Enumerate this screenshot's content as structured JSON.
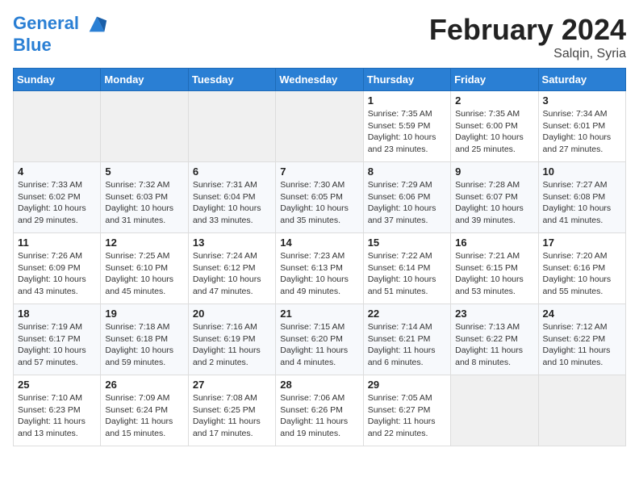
{
  "header": {
    "logo_line1": "General",
    "logo_line2": "Blue",
    "month_title": "February 2024",
    "subtitle": "Salqin, Syria"
  },
  "weekdays": [
    "Sunday",
    "Monday",
    "Tuesday",
    "Wednesday",
    "Thursday",
    "Friday",
    "Saturday"
  ],
  "weeks": [
    [
      {
        "day": "",
        "info": ""
      },
      {
        "day": "",
        "info": ""
      },
      {
        "day": "",
        "info": ""
      },
      {
        "day": "",
        "info": ""
      },
      {
        "day": "1",
        "info": "Sunrise: 7:35 AM\nSunset: 5:59 PM\nDaylight: 10 hours\nand 23 minutes."
      },
      {
        "day": "2",
        "info": "Sunrise: 7:35 AM\nSunset: 6:00 PM\nDaylight: 10 hours\nand 25 minutes."
      },
      {
        "day": "3",
        "info": "Sunrise: 7:34 AM\nSunset: 6:01 PM\nDaylight: 10 hours\nand 27 minutes."
      }
    ],
    [
      {
        "day": "4",
        "info": "Sunrise: 7:33 AM\nSunset: 6:02 PM\nDaylight: 10 hours\nand 29 minutes."
      },
      {
        "day": "5",
        "info": "Sunrise: 7:32 AM\nSunset: 6:03 PM\nDaylight: 10 hours\nand 31 minutes."
      },
      {
        "day": "6",
        "info": "Sunrise: 7:31 AM\nSunset: 6:04 PM\nDaylight: 10 hours\nand 33 minutes."
      },
      {
        "day": "7",
        "info": "Sunrise: 7:30 AM\nSunset: 6:05 PM\nDaylight: 10 hours\nand 35 minutes."
      },
      {
        "day": "8",
        "info": "Sunrise: 7:29 AM\nSunset: 6:06 PM\nDaylight: 10 hours\nand 37 minutes."
      },
      {
        "day": "9",
        "info": "Sunrise: 7:28 AM\nSunset: 6:07 PM\nDaylight: 10 hours\nand 39 minutes."
      },
      {
        "day": "10",
        "info": "Sunrise: 7:27 AM\nSunset: 6:08 PM\nDaylight: 10 hours\nand 41 minutes."
      }
    ],
    [
      {
        "day": "11",
        "info": "Sunrise: 7:26 AM\nSunset: 6:09 PM\nDaylight: 10 hours\nand 43 minutes."
      },
      {
        "day": "12",
        "info": "Sunrise: 7:25 AM\nSunset: 6:10 PM\nDaylight: 10 hours\nand 45 minutes."
      },
      {
        "day": "13",
        "info": "Sunrise: 7:24 AM\nSunset: 6:12 PM\nDaylight: 10 hours\nand 47 minutes."
      },
      {
        "day": "14",
        "info": "Sunrise: 7:23 AM\nSunset: 6:13 PM\nDaylight: 10 hours\nand 49 minutes."
      },
      {
        "day": "15",
        "info": "Sunrise: 7:22 AM\nSunset: 6:14 PM\nDaylight: 10 hours\nand 51 minutes."
      },
      {
        "day": "16",
        "info": "Sunrise: 7:21 AM\nSunset: 6:15 PM\nDaylight: 10 hours\nand 53 minutes."
      },
      {
        "day": "17",
        "info": "Sunrise: 7:20 AM\nSunset: 6:16 PM\nDaylight: 10 hours\nand 55 minutes."
      }
    ],
    [
      {
        "day": "18",
        "info": "Sunrise: 7:19 AM\nSunset: 6:17 PM\nDaylight: 10 hours\nand 57 minutes."
      },
      {
        "day": "19",
        "info": "Sunrise: 7:18 AM\nSunset: 6:18 PM\nDaylight: 10 hours\nand 59 minutes."
      },
      {
        "day": "20",
        "info": "Sunrise: 7:16 AM\nSunset: 6:19 PM\nDaylight: 11 hours\nand 2 minutes."
      },
      {
        "day": "21",
        "info": "Sunrise: 7:15 AM\nSunset: 6:20 PM\nDaylight: 11 hours\nand 4 minutes."
      },
      {
        "day": "22",
        "info": "Sunrise: 7:14 AM\nSunset: 6:21 PM\nDaylight: 11 hours\nand 6 minutes."
      },
      {
        "day": "23",
        "info": "Sunrise: 7:13 AM\nSunset: 6:22 PM\nDaylight: 11 hours\nand 8 minutes."
      },
      {
        "day": "24",
        "info": "Sunrise: 7:12 AM\nSunset: 6:22 PM\nDaylight: 11 hours\nand 10 minutes."
      }
    ],
    [
      {
        "day": "25",
        "info": "Sunrise: 7:10 AM\nSunset: 6:23 PM\nDaylight: 11 hours\nand 13 minutes."
      },
      {
        "day": "26",
        "info": "Sunrise: 7:09 AM\nSunset: 6:24 PM\nDaylight: 11 hours\nand 15 minutes."
      },
      {
        "day": "27",
        "info": "Sunrise: 7:08 AM\nSunset: 6:25 PM\nDaylight: 11 hours\nand 17 minutes."
      },
      {
        "day": "28",
        "info": "Sunrise: 7:06 AM\nSunset: 6:26 PM\nDaylight: 11 hours\nand 19 minutes."
      },
      {
        "day": "29",
        "info": "Sunrise: 7:05 AM\nSunset: 6:27 PM\nDaylight: 11 hours\nand 22 minutes."
      },
      {
        "day": "",
        "info": ""
      },
      {
        "day": "",
        "info": ""
      }
    ]
  ]
}
